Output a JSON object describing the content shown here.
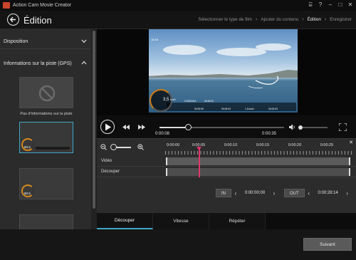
{
  "window": {
    "title": "Action Cam Movie Creator",
    "controls": [
      "toolbox-icon",
      "help-icon",
      "minimize-icon",
      "maximize-icon",
      "close-icon"
    ]
  },
  "header": {
    "title": "Édition",
    "steps": [
      {
        "label": "Sélectionner le type de film",
        "active": false
      },
      {
        "label": "Ajouter du contenu",
        "active": false
      },
      {
        "label": "Édition",
        "active": true
      },
      {
        "label": "Enregistrer",
        "active": false
      }
    ]
  },
  "sidebar": {
    "sections": [
      {
        "label": "Disposition",
        "expanded": false
      },
      {
        "label": "Informations sur la piste (GPS)",
        "expanded": true
      }
    ],
    "no_info_label": "Pas d'informations sur la piste",
    "thumbnails": [
      {
        "kind": "none",
        "selected": false
      },
      {
        "kind": "gauge",
        "value": "80.5",
        "selected": true
      },
      {
        "kind": "gauge",
        "value": "80.5",
        "selected": false
      },
      {
        "kind": "plain",
        "selected": false
      }
    ]
  },
  "video": {
    "tag": "18 5d",
    "hud": {
      "speed": "3,5",
      "speed_unit": "km/h",
      "date": "17/02/2014",
      "clock": "09:19:22",
      "elapsed": "00:00:05",
      "distance_time": "00:00:03",
      "pace": "1,5 km/h",
      "altitude": "00:00:03"
    }
  },
  "player": {
    "current_time": "0:00:08",
    "total_time": "0:00:35",
    "progress": 0.23,
    "volume": 0.0
  },
  "timeline": {
    "ruler": [
      "0:00:00",
      "0:00:05",
      "0:00:10",
      "0:00:15",
      "0:00:20",
      "0:00:25"
    ],
    "tracks": [
      "Vidéo",
      "Découper"
    ],
    "in_label": "IN",
    "in_time": "0:00:00:00",
    "out_label": "OUT",
    "out_time": "0:00:28:14"
  },
  "tabs": [
    {
      "label": "Découper",
      "active": true
    },
    {
      "label": "Vitesse",
      "active": false
    },
    {
      "label": "Répéter",
      "active": false
    }
  ],
  "footer": {
    "next_label": "Suivant"
  },
  "colors": {
    "accent": "#3fa7c7",
    "playhead": "#e2356c",
    "gauge": "#cc7a14"
  }
}
